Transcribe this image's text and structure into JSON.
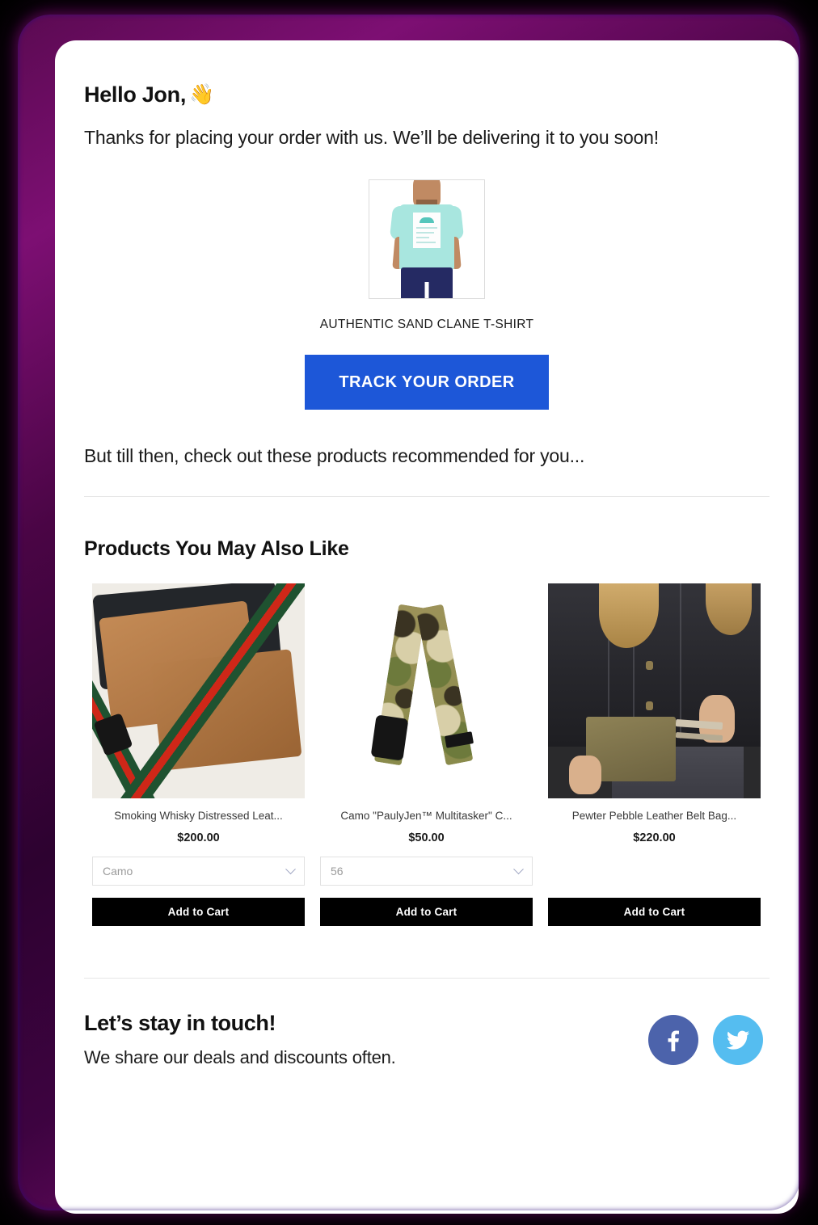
{
  "email": {
    "greeting": "Hello Jon,",
    "greeting_emoji": "👋",
    "intro": "Thanks for placing your order with us. We’ll be delivering it to you soon!",
    "hero": {
      "product_title": "AUTHENTIC SAND CLANE T-SHIRT",
      "cta_label": "TRACK YOUR ORDER",
      "cta_color": "#1d57d8",
      "image_alt": "man-wearing-mint-t-shirt"
    },
    "teaser": "But till then, check out these products recommended for you...",
    "recommendations": {
      "section_title": "Products You May Also Like",
      "products": [
        {
          "name": "Smoking Whisky Distressed Leat...",
          "price": "$200.00",
          "variant": "Camo",
          "has_variant": true,
          "cart_label": "Add to Cart",
          "image_alt": "tan-leather-belt-bag-with-green-red-strap"
        },
        {
          "name": "Camo \"PaulyJen™ Multitasker\" C...",
          "price": "$50.00",
          "variant": "56",
          "has_variant": true,
          "cart_label": "Add to Cart",
          "image_alt": "camouflage-strap-with-black-buckle"
        },
        {
          "name": "Pewter Pebble Leather Belt Bag...",
          "price": "$220.00",
          "variant": "",
          "has_variant": false,
          "cart_label": "Add to Cart",
          "image_alt": "woman-in-black-denim-jacket-with-belt-bag"
        }
      ]
    },
    "footer": {
      "title": "Let’s stay in touch!",
      "subtitle": "We share our deals and discounts often.",
      "socials": [
        {
          "name": "facebook",
          "glyph": "f",
          "color": "#4c63ab"
        },
        {
          "name": "twitter",
          "glyph": "🐦",
          "color": "#55bdf0"
        }
      ]
    }
  },
  "theme": {
    "frame_color": "#6d0a63",
    "background": "#000000",
    "card_background": "#ffffff",
    "cart_button_color": "#000000"
  }
}
